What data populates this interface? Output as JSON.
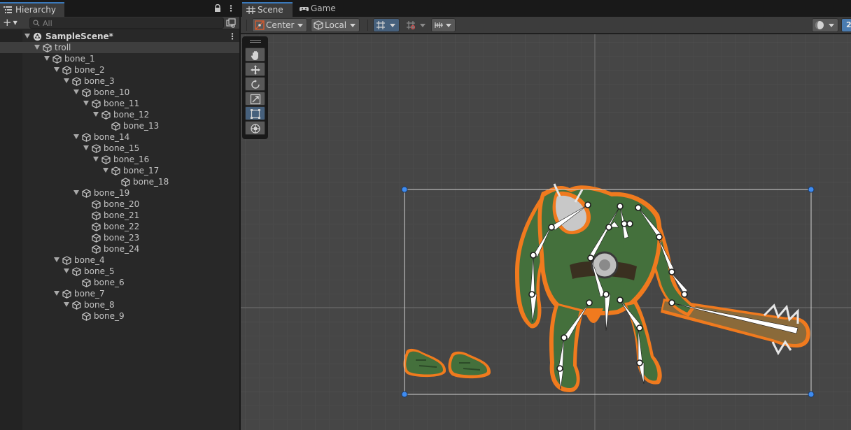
{
  "hierarchy": {
    "tab_label": "Hierarchy",
    "add_button": "+",
    "search_placeholder": "All",
    "scene_name": "SampleScene*",
    "items": [
      {
        "label": "troll",
        "depth": 1,
        "expanded": true,
        "selected": true
      },
      {
        "label": "bone_1",
        "depth": 2,
        "expanded": true
      },
      {
        "label": "bone_2",
        "depth": 3,
        "expanded": true
      },
      {
        "label": "bone_3",
        "depth": 4,
        "expanded": true
      },
      {
        "label": "bone_10",
        "depth": 5,
        "expanded": true
      },
      {
        "label": "bone_11",
        "depth": 6,
        "expanded": true
      },
      {
        "label": "bone_12",
        "depth": 7,
        "expanded": true
      },
      {
        "label": "bone_13",
        "depth": 8,
        "expanded": false
      },
      {
        "label": "bone_14",
        "depth": 5,
        "expanded": true
      },
      {
        "label": "bone_15",
        "depth": 6,
        "expanded": true
      },
      {
        "label": "bone_16",
        "depth": 7,
        "expanded": true
      },
      {
        "label": "bone_17",
        "depth": 8,
        "expanded": true
      },
      {
        "label": "bone_18",
        "depth": 9,
        "expanded": false
      },
      {
        "label": "bone_19",
        "depth": 5,
        "expanded": true
      },
      {
        "label": "bone_20",
        "depth": 6,
        "expanded": false
      },
      {
        "label": "bone_21",
        "depth": 6,
        "expanded": false
      },
      {
        "label": "bone_22",
        "depth": 6,
        "expanded": false
      },
      {
        "label": "bone_23",
        "depth": 6,
        "expanded": false
      },
      {
        "label": "bone_24",
        "depth": 6,
        "expanded": false
      },
      {
        "label": "bone_4",
        "depth": 3,
        "expanded": true
      },
      {
        "label": "bone_5",
        "depth": 4,
        "expanded": true
      },
      {
        "label": "bone_6",
        "depth": 5,
        "expanded": false
      },
      {
        "label": "bone_7",
        "depth": 3,
        "expanded": true
      },
      {
        "label": "bone_8",
        "depth": 4,
        "expanded": true
      },
      {
        "label": "bone_9",
        "depth": 5,
        "expanded": false
      }
    ]
  },
  "scene_tabs": {
    "scene_label": "Scene",
    "game_label": "Game"
  },
  "scene_toolbar": {
    "pivot_label": "Center",
    "space_label": "Local",
    "right_value": "2"
  },
  "tools": [
    "hand-tool",
    "move-tool",
    "rotate-tool",
    "scale-tool",
    "rect-tool",
    "transform-tool"
  ],
  "colors": {
    "accent": "#3a79bb",
    "selection_blue": "#46607c",
    "viewport_bg": "#464646",
    "sprite_outline": "#f07a1e",
    "troll_skin": "#3f6b3a",
    "bone": "#ffffff",
    "rect_handle": "#3f8cf0"
  }
}
